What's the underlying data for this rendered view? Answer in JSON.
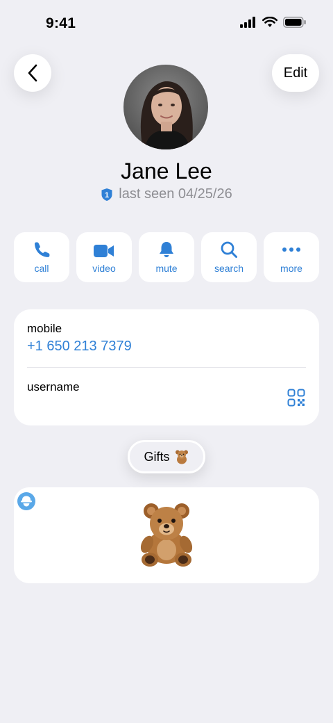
{
  "status_bar": {
    "time": "9:41"
  },
  "nav": {
    "edit_label": "Edit"
  },
  "profile": {
    "name": "Jane Lee",
    "last_seen": "last seen 04/25/26",
    "badge_number": "1"
  },
  "actions": [
    {
      "label": "call",
      "icon": "phone-icon"
    },
    {
      "label": "video",
      "icon": "video-camera-icon"
    },
    {
      "label": "mute",
      "icon": "bell-icon"
    },
    {
      "label": "search",
      "icon": "search-icon"
    },
    {
      "label": "more",
      "icon": "more-dots-icon"
    }
  ],
  "info": {
    "mobile_label": "mobile",
    "mobile_value": "+1 650 213 7379",
    "username_label": "username"
  },
  "gifts": {
    "label": "Gifts",
    "emoji": "🧸"
  },
  "colors": {
    "accent": "#2f80d6",
    "background": "#efeff4",
    "card": "#ffffff",
    "secondary_text": "#8e8e93"
  }
}
